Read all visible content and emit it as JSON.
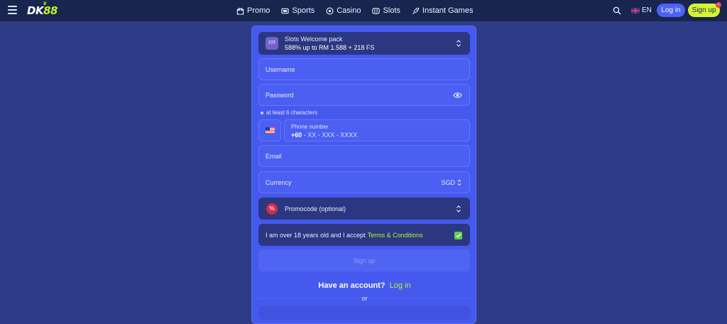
{
  "header": {
    "logo": {
      "text_main": "DK",
      "text_num": "88"
    },
    "nav": [
      {
        "label": "Promo",
        "icon": "gift-icon"
      },
      {
        "label": "Sports",
        "icon": "ticket-icon"
      },
      {
        "label": "Casino",
        "icon": "chip-icon"
      },
      {
        "label": "Slots",
        "icon": "slot-machine-icon"
      },
      {
        "label": "Instant Games",
        "icon": "rocket-icon"
      }
    ],
    "language": "EN",
    "login_label": "Log in",
    "signup_label": "Sign up"
  },
  "form": {
    "welcome": {
      "title": "Slots Welcome pack",
      "subtitle": "588% up to RM 1.588 + 218 FS"
    },
    "username_placeholder": "Username",
    "password_placeholder": "Password",
    "password_hint": "at least 6 characters",
    "phone": {
      "label": "Phone number",
      "prefix": "+60",
      "mask": " - XX - XXX - XXXX"
    },
    "email_placeholder": "Email",
    "currency": {
      "label": "Currency",
      "value": "SGD"
    },
    "promocode_label": "Promocode (optional)",
    "terms": {
      "text": "I am over 18 years old and I accept",
      "link": "Terms & Conditions",
      "checked": true
    },
    "submit_label": "Sign up",
    "have_account": "Have an account?",
    "login_link": "Log in",
    "or_label": "or"
  },
  "colors": {
    "background": "#2e3b86",
    "topbar": "#18254f",
    "panel": "#4659ef",
    "accent_green": "#b6f23a",
    "signup_button": "#d6f530",
    "login_button": "#4a62f5"
  }
}
